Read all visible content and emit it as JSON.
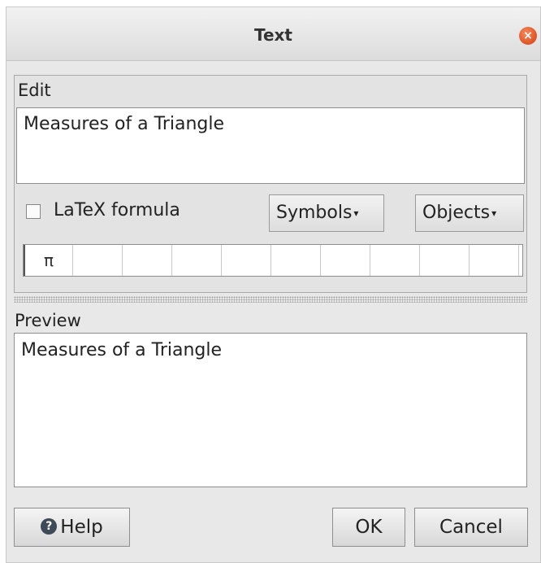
{
  "window": {
    "title": "Text",
    "close_icon": "×"
  },
  "edit": {
    "label": "Edit",
    "value": "Measures of a Triangle",
    "latex_label": "LaTeX formula",
    "latex_checked": false,
    "symbols_label": "Symbols",
    "objects_label": "Objects",
    "caret": "▾"
  },
  "symbols": [
    "π",
    "",
    "",
    "",
    "",
    "",
    "",
    "",
    "",
    "",
    ""
  ],
  "preview": {
    "label": "Preview",
    "text": "Measures of a Triangle"
  },
  "buttons": {
    "help_icon": "?",
    "help": "Help",
    "ok": "OK",
    "cancel": "Cancel"
  },
  "colors": {
    "close_accent": "#e05a2b",
    "panel_bg": "#e8e8e8"
  }
}
